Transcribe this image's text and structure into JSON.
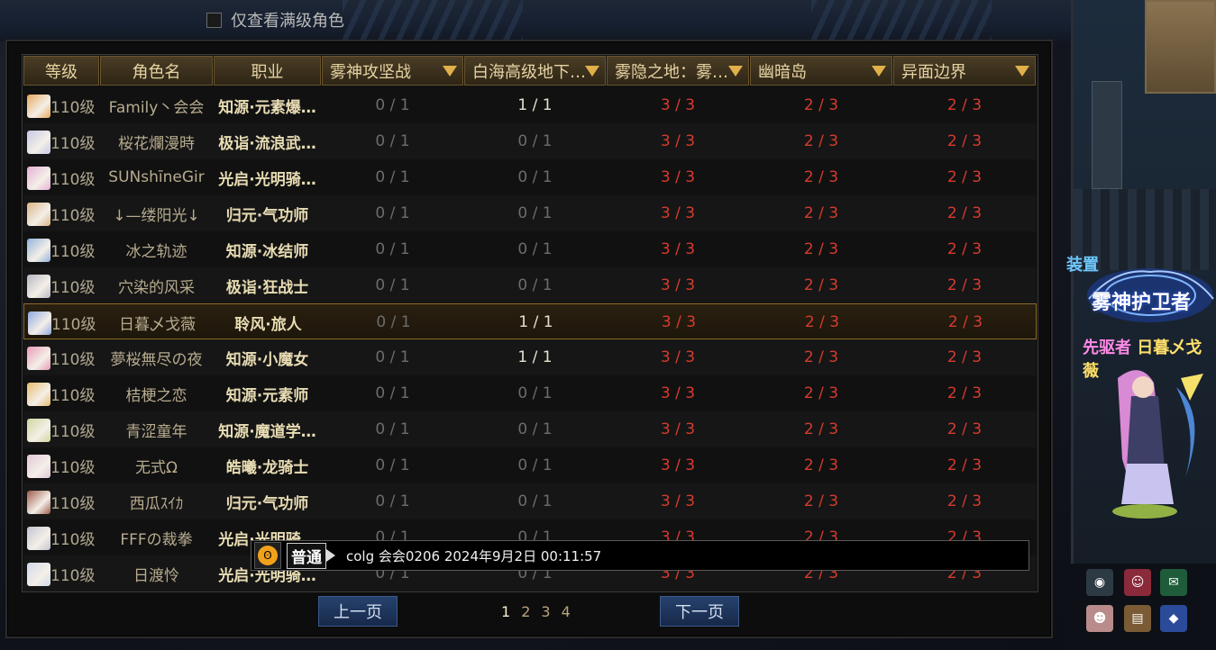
{
  "filter": {
    "label": "仅查看满级角色",
    "checked": false
  },
  "table": {
    "headers": [
      {
        "label": "等级",
        "dropdown": false
      },
      {
        "label": "角色名",
        "dropdown": false
      },
      {
        "label": "职业",
        "dropdown": false
      },
      {
        "label": "雾神攻坚战",
        "dropdown": true
      },
      {
        "label": "白海高级地下…",
        "dropdown": true
      },
      {
        "label": "雾隐之地：雾…",
        "dropdown": true
      },
      {
        "label": "幽暗岛",
        "dropdown": true
      },
      {
        "label": "异面边界",
        "dropdown": true
      }
    ],
    "rows": [
      {
        "avatar_color": "#e7a85c",
        "level": "110级",
        "name": "Family丶会会",
        "job": "知源·元素爆…",
        "c1": "0 / 1",
        "c2": "1 / 1",
        "c3": "3 / 3",
        "c4": "2 / 3",
        "c5": "2 / 3"
      },
      {
        "avatar_color": "#c6c9e8",
        "level": "110级",
        "name": "桜花爛漫時",
        "job": "极诣·流浪武…",
        "c1": "0 / 1",
        "c2": "0 / 1",
        "c3": "3 / 3",
        "c4": "2 / 3",
        "c5": "2 / 3"
      },
      {
        "avatar_color": "#e4b0d4",
        "level": "110级",
        "name": "SUNshīneGir",
        "job": "光启·光明骑…",
        "c1": "0 / 1",
        "c2": "0 / 1",
        "c3": "3 / 3",
        "c4": "2 / 3",
        "c5": "2 / 3"
      },
      {
        "avatar_color": "#d9b585",
        "level": "110级",
        "name": "↓—缕阳光↓",
        "job": "归元·气功师",
        "c1": "0 / 1",
        "c2": "0 / 1",
        "c3": "3 / 3",
        "c4": "2 / 3",
        "c5": "2 / 3"
      },
      {
        "avatar_color": "#8fb2d9",
        "level": "110级",
        "name": "冰之轨迹",
        "job": "知源·冰结师",
        "c1": "0 / 1",
        "c2": "0 / 1",
        "c3": "3 / 3",
        "c4": "2 / 3",
        "c5": "2 / 3"
      },
      {
        "avatar_color": "#b7b7c3",
        "level": "110级",
        "name": "穴染的风采",
        "job": "极诣·狂战士",
        "c1": "0 / 1",
        "c2": "0 / 1",
        "c3": "3 / 3",
        "c4": "2 / 3",
        "c5": "2 / 3"
      },
      {
        "avatar_color": "#8fa8e0",
        "level": "110级",
        "name": "日暮乄戈薇",
        "job": "聆风·旅人",
        "c1": "0 / 1",
        "c2": "1 / 1",
        "c3": "3 / 3",
        "c4": "2 / 3",
        "c5": "2 / 3",
        "selected": true
      },
      {
        "avatar_color": "#e79ab7",
        "level": "110级",
        "name": "夢桜無尽の夜",
        "job": "知源·小魔女",
        "c1": "0 / 1",
        "c2": "1 / 1",
        "c3": "3 / 3",
        "c4": "2 / 3",
        "c5": "2 / 3"
      },
      {
        "avatar_color": "#e6bd6d",
        "level": "110级",
        "name": "桔梗之恋",
        "job": "知源·元素师",
        "c1": "0 / 1",
        "c2": "0 / 1",
        "c3": "3 / 3",
        "c4": "2 / 3",
        "c5": "2 / 3"
      },
      {
        "avatar_color": "#cfd69a",
        "level": "110级",
        "name": "青涩童年",
        "job": "知源·魔道学…",
        "c1": "0 / 1",
        "c2": "0 / 1",
        "c3": "3 / 3",
        "c4": "2 / 3",
        "c5": "2 / 3"
      },
      {
        "avatar_color": "#e2c7d6",
        "level": "110级",
        "name": "无式Ω",
        "job": "皓曦·龙骑士",
        "c1": "0 / 1",
        "c2": "0 / 1",
        "c3": "3 / 3",
        "c4": "2 / 3",
        "c5": "2 / 3"
      },
      {
        "avatar_color": "#9c5a4a",
        "level": "110级",
        "name": "西瓜ｽｲｶ",
        "job": "归元·气功师",
        "c1": "0 / 1",
        "c2": "0 / 1",
        "c3": "3 / 3",
        "c4": "2 / 3",
        "c5": "2 / 3"
      },
      {
        "avatar_color": "#c3c3d0",
        "level": "110级",
        "name": "FFFの裁拳",
        "job": "光启·光明骑…",
        "c1": "0 / 1",
        "c2": "0 / 1",
        "c3": "3 / 3",
        "c4": "2 / 3",
        "c5": "2 / 3"
      },
      {
        "avatar_color": "#d0d9e8",
        "level": "110级",
        "name": "日渡怜",
        "job": "光启·光明骑…",
        "c1": "0 / 1",
        "c2": "0 / 1",
        "c3": "3 / 3",
        "c4": "2 / 3",
        "c5": "2 / 3"
      }
    ]
  },
  "pagination": {
    "prev_label": "上一页",
    "next_label": "下一页",
    "pages": [
      "1",
      "2",
      "3",
      "4"
    ],
    "current": "1"
  },
  "chat": {
    "channel": "普通",
    "message": "colg 会会0206 2024年9月2日 00:11:57",
    "icon": "emote-face-icon"
  },
  "scene": {
    "label_zhuangzhi": "装置",
    "guild_title": "雾神护卫者",
    "char_prefix": "先驱者",
    "char_name": "日暮乄戈薇"
  }
}
